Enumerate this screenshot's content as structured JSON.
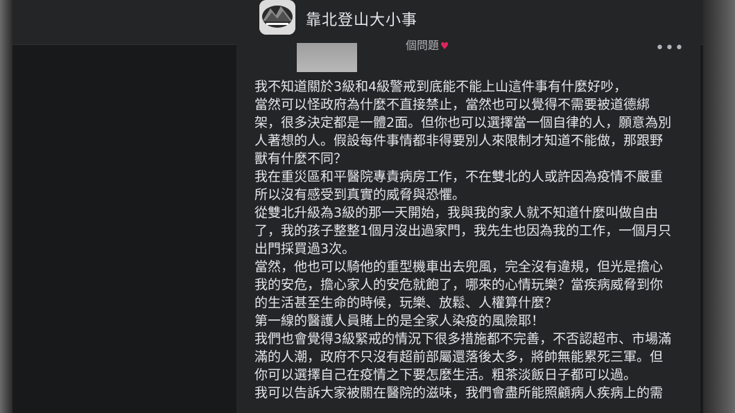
{
  "header": {
    "group_name": "靠北登山大小事",
    "avatar_icon": "mountain-group-avatar-icon"
  },
  "post": {
    "meta_text": "個問題",
    "heart_icon": "heart-icon",
    "more_icon": "more-options-icon",
    "more_label": "•••",
    "lines": [
      "我不知道關於3級和4級警戒到底能不能上山這件事有什麼好吵，",
      "當然可以怪政府為什麼不直接禁止，當然也可以覺得不需要被道德綁",
      "架，很多決定都是一體2面。但你也可以選擇當一個自律的人，願意為別",
      "人著想的人。假設每件事情都非得要別人來限制才知道不能做，那跟野",
      "獸有什麼不同？",
      "我在重災區和平醫院專責病房工作，不在雙北的人或許因為疫情不嚴重",
      "所以沒有感受到真實的威脅與恐懼。",
      "從雙北升級為3級的那一天開始，我與我的家人就不知道什麼叫做自由",
      "了，我的孩子整整1個月沒出過家門，我先生也因為我的工作，一個月只",
      "出門採買過3次。",
      "當然，他也可以騎他的重型機車出去兜風，完全沒有違規，但光是擔心",
      "我的安危，擔心家人的安危就飽了，哪來的心情玩樂？當疾病威脅到你",
      "的生活甚至生命的時候，玩樂、放鬆、人權算什麼？",
      "第一線的醫護人員賭上的是全家人染疫的風險耶！",
      "我們也會覺得3級緊戒的情況下很多措施都不完善，不否認超市、市場滿",
      "滿的人潮，政府不只沒有超前部屬還落後太多，將帥無能累死三軍。但",
      "你可以選擇自己在疫情之下要怎麼生活。粗茶淡飯日子都可以過。",
      "我可以告訴大家被關在醫院的滋味，我們會盡所能照顧病人疾病上的需"
    ]
  }
}
